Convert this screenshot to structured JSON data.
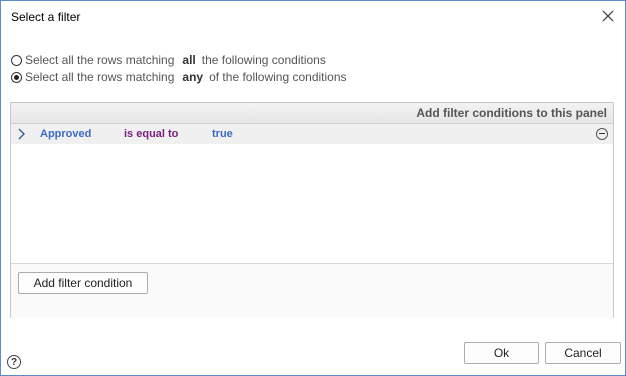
{
  "dialog": {
    "title": "Select a filter"
  },
  "match_options": [
    {
      "prefix": "Select all the rows matching",
      "keyword": "all",
      "suffix": "the following conditions",
      "selected": false
    },
    {
      "prefix": "Select all the rows matching",
      "keyword": "any",
      "suffix": "of the following conditions",
      "selected": true
    }
  ],
  "panel": {
    "header_link": "Add filter conditions to this panel",
    "conditions": [
      {
        "field": "Approved",
        "operator": "is equal to",
        "value": "true"
      }
    ],
    "add_button": "Add filter condition"
  },
  "footer": {
    "ok_label": "Ok",
    "cancel_label": "Cancel",
    "help_glyph": "?"
  },
  "icons": {
    "close": "close-icon",
    "expand": "chevron-right-icon",
    "remove": "minus-circle-icon",
    "help": "help-icon"
  }
}
